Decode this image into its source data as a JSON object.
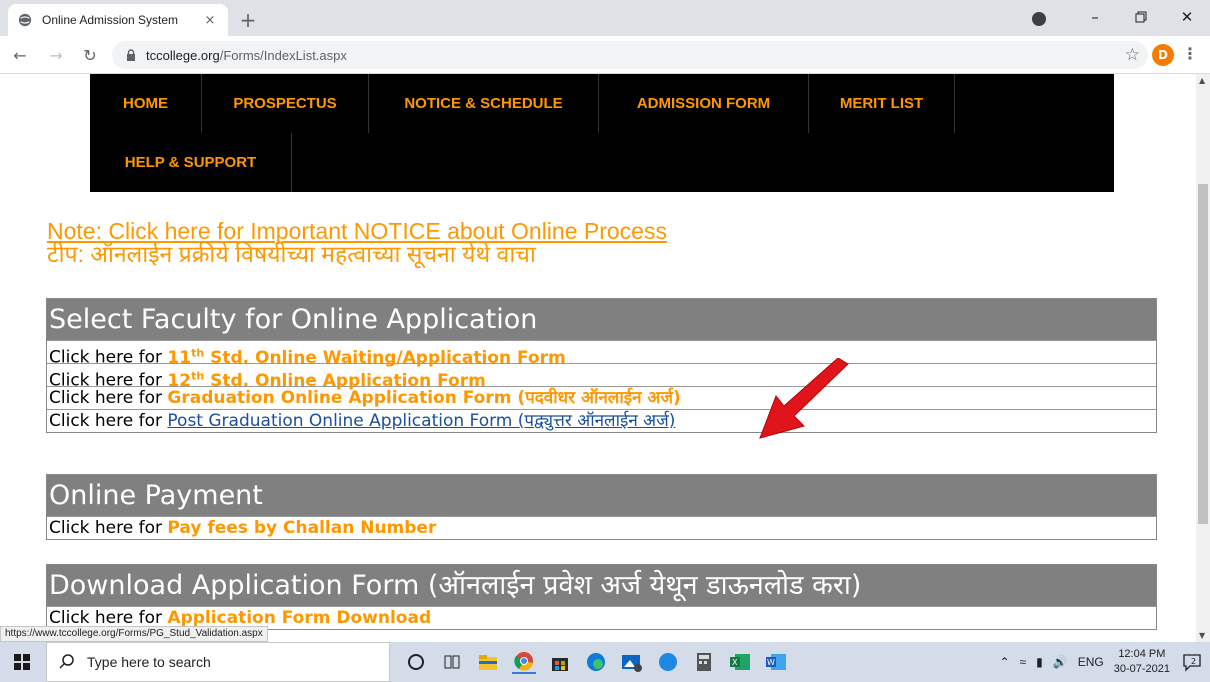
{
  "browser": {
    "tab_title": "Online Admission System",
    "tab_close": "×",
    "new_tab": "+",
    "url_domain": "tccollege.org",
    "url_path": "/Forms/IndexList.aspx",
    "profile_initial": "D",
    "status_url": "https://www.tccollege.org/Forms/PG_Stud_Validation.aspx"
  },
  "nav": {
    "items": [
      {
        "label": "HOME"
      },
      {
        "label": "PROSPECTUS"
      },
      {
        "label": "NOTICE & SCHEDULE"
      },
      {
        "label": "ADMISSION FORM"
      },
      {
        "label": "MERIT LIST"
      },
      {
        "label": "HELP & SUPPORT"
      }
    ]
  },
  "note": {
    "english": "Note: Click here for Important NOTICE about Online Process",
    "marathi": "टीप: ऑनलाईन प्रक्रीये विषयीच्या महत्वाच्या सूचना येथे वाचा"
  },
  "faculty": {
    "heading": "Select Faculty for Online Application",
    "prefix": "Click here for ",
    "row1_num": "11",
    "row1_sup": "th",
    "row1_link": " Std. Online Waiting/Application Form",
    "row2_num": "12",
    "row2_sup": "th",
    "row2_link": " Std. Online Application Form",
    "row3_link": "Graduation Online Application Form (पदवीधर ऑनलाईन अर्ज)",
    "row4_link": "Post Graduation Online Application Form (पद्व्युत्तर ऑनलाईन अर्ज)"
  },
  "payment": {
    "heading": "Online Payment",
    "prefix": "Click here for ",
    "link": "Pay fees by Challan Number"
  },
  "download": {
    "heading": "Download Application Form (ऑनलाईन प्रवेश अर्ज येथून डाऊनलोड करा)",
    "prefix": "Click here for ",
    "link": "Application Form Download"
  },
  "taskbar": {
    "search_placeholder": "Type here to search",
    "language": "ENG",
    "time": "12:04 PM",
    "date": "30-07-2021",
    "notification_count": "2"
  },
  "colors": {
    "accent": "#ff9800",
    "link_active": "#1a4fa0",
    "panel_header": "#808080",
    "arrow": "#e0141b"
  }
}
